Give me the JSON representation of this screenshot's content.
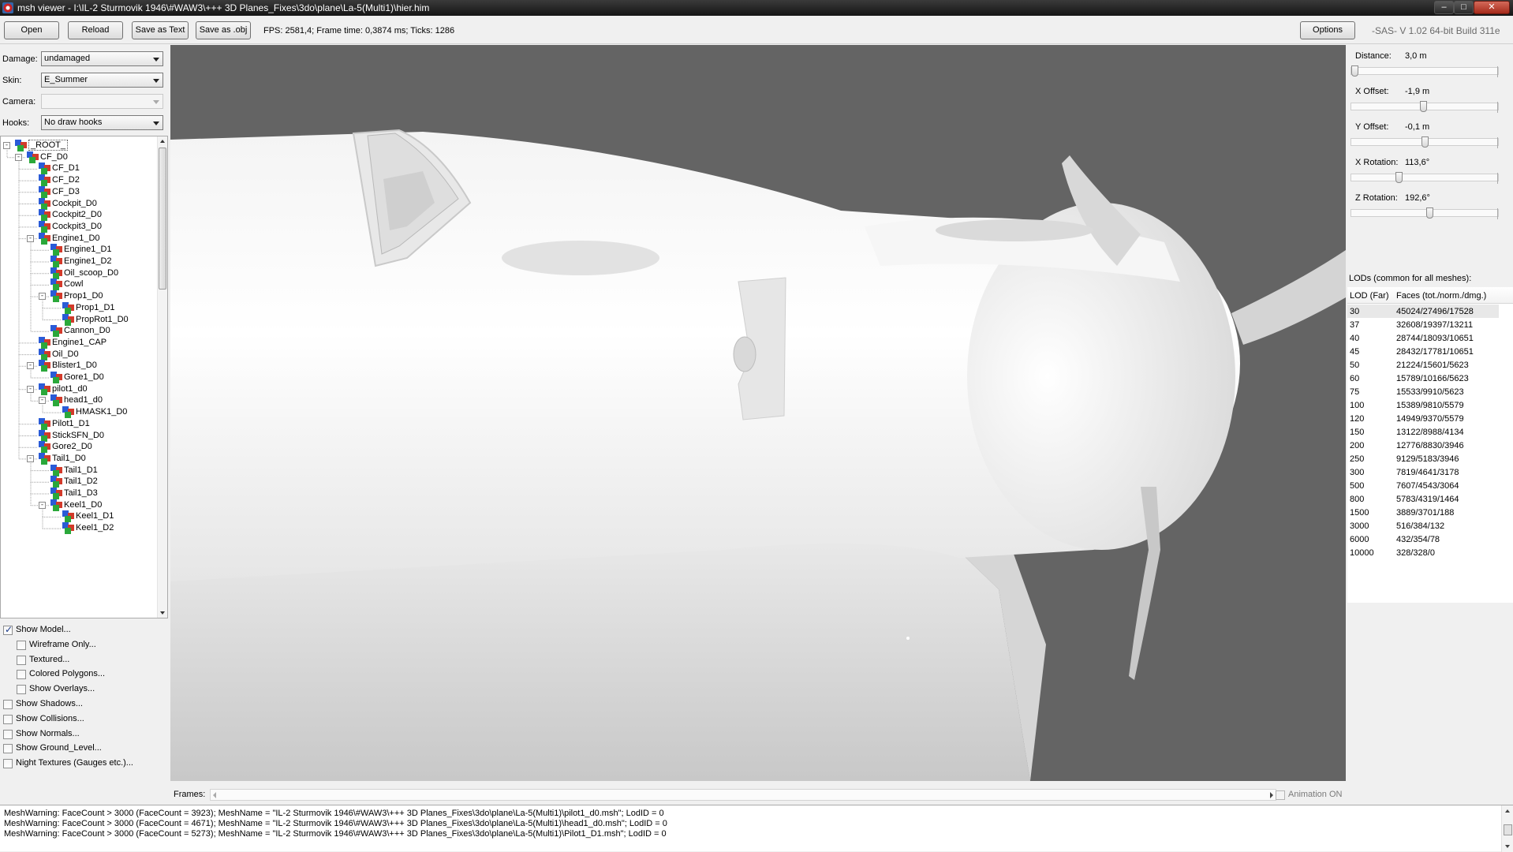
{
  "window": {
    "title": "msh viewer - I:\\IL-2 Sturmovik 1946\\#WAW3\\+++ 3D Planes_Fixes\\3do\\plane\\La-5(Multi1)\\hier.him",
    "minimize": "–",
    "maximize": "□",
    "close": "✕"
  },
  "toolbar": {
    "open": "Open",
    "reload": "Reload",
    "save_text": "Save as Text",
    "save_obj": "Save as .obj",
    "fps": "FPS: 2581,4; Frame time: 0,3874 ms; Ticks: 1286",
    "options": "Options",
    "version": "-SAS- V 1.02  64-bit  Build 311e"
  },
  "fields": {
    "damage_label": "Damage:",
    "damage_value": "undamaged",
    "skin_label": "Skin:",
    "skin_value": "E_Summer",
    "camera_label": "Camera:",
    "camera_value": "",
    "hooks_label": "Hooks:",
    "hooks_value": "No draw hooks"
  },
  "tree": [
    {
      "label": "_ROOT_",
      "depth": 0,
      "exp": "-"
    },
    {
      "label": "CF_D0",
      "depth": 1,
      "exp": "-"
    },
    {
      "label": "CF_D1",
      "depth": 2,
      "exp": ""
    },
    {
      "label": "CF_D2",
      "depth": 2,
      "exp": ""
    },
    {
      "label": "CF_D3",
      "depth": 2,
      "exp": ""
    },
    {
      "label": "Cockpit_D0",
      "depth": 2,
      "exp": ""
    },
    {
      "label": "Cockpit2_D0",
      "depth": 2,
      "exp": ""
    },
    {
      "label": "Cockpit3_D0",
      "depth": 2,
      "exp": ""
    },
    {
      "label": "Engine1_D0",
      "depth": 2,
      "exp": "-"
    },
    {
      "label": "Engine1_D1",
      "depth": 3,
      "exp": ""
    },
    {
      "label": "Engine1_D2",
      "depth": 3,
      "exp": ""
    },
    {
      "label": "Oil_scoop_D0",
      "depth": 3,
      "exp": ""
    },
    {
      "label": "Cowl",
      "depth": 3,
      "exp": ""
    },
    {
      "label": "Prop1_D0",
      "depth": 3,
      "exp": "-"
    },
    {
      "label": "Prop1_D1",
      "depth": 4,
      "exp": ""
    },
    {
      "label": "PropRot1_D0",
      "depth": 4,
      "exp": ""
    },
    {
      "label": "Cannon_D0",
      "depth": 3,
      "exp": ""
    },
    {
      "label": "Engine1_CAP",
      "depth": 2,
      "exp": ""
    },
    {
      "label": "Oil_D0",
      "depth": 2,
      "exp": ""
    },
    {
      "label": "Blister1_D0",
      "depth": 2,
      "exp": "-"
    },
    {
      "label": "Gore1_D0",
      "depth": 3,
      "exp": ""
    },
    {
      "label": "pilot1_d0",
      "depth": 2,
      "exp": "-"
    },
    {
      "label": "head1_d0",
      "depth": 3,
      "exp": "-"
    },
    {
      "label": "HMASK1_D0",
      "depth": 4,
      "exp": ""
    },
    {
      "label": "Pilot1_D1",
      "depth": 2,
      "exp": ""
    },
    {
      "label": "StickSFN_D0",
      "depth": 2,
      "exp": ""
    },
    {
      "label": "Gore2_D0",
      "depth": 2,
      "exp": ""
    },
    {
      "label": "Tail1_D0",
      "depth": 2,
      "exp": "-"
    },
    {
      "label": "Tail1_D1",
      "depth": 3,
      "exp": ""
    },
    {
      "label": "Tail1_D2",
      "depth": 3,
      "exp": ""
    },
    {
      "label": "Tail1_D3",
      "depth": 3,
      "exp": ""
    },
    {
      "label": "Keel1_D0",
      "depth": 3,
      "exp": "-"
    },
    {
      "label": "Keel1_D1",
      "depth": 4,
      "exp": ""
    },
    {
      "label": "Keel1_D2",
      "depth": 4,
      "exp": ""
    }
  ],
  "checkboxes": [
    {
      "label": "Show Model...",
      "checked": true,
      "indent": 0
    },
    {
      "label": "Wireframe Only...",
      "checked": false,
      "indent": 1
    },
    {
      "label": "Textured...",
      "checked": false,
      "indent": 1
    },
    {
      "label": "Colored Polygons...",
      "checked": false,
      "indent": 1
    },
    {
      "label": "Show Overlays...",
      "checked": false,
      "indent": 1
    },
    {
      "label": "Show Shadows...",
      "checked": false,
      "indent": 0
    },
    {
      "label": "Show Collisions...",
      "checked": false,
      "indent": 0
    },
    {
      "label": "Show Normals...",
      "checked": false,
      "indent": 0
    },
    {
      "label": "Show Ground_Level...",
      "checked": false,
      "indent": 0
    },
    {
      "label": "Night Textures (Gauges etc.)...",
      "checked": false,
      "indent": 0
    }
  ],
  "frames": {
    "label": "Frames:",
    "animation": "Animation ON"
  },
  "log": [
    "MeshWarning: FaceCount > 3000 (FaceCount = 3923); MeshName = \"IL-2 Sturmovik 1946\\#WAW3\\+++ 3D Planes_Fixes\\3do\\plane\\La-5(Multi1)\\pilot1_d0.msh\"; LodID = 0",
    "MeshWarning: FaceCount > 3000 (FaceCount = 4671); MeshName = \"IL-2 Sturmovik 1946\\#WAW3\\+++ 3D Planes_Fixes\\3do\\plane\\La-5(Multi1)\\head1_d0.msh\"; LodID = 0",
    "MeshWarning: FaceCount > 3000 (FaceCount = 5273); MeshName = \"IL-2 Sturmovik 1946\\#WAW3\\+++ 3D Planes_Fixes\\3do\\plane\\La-5(Multi1)\\Pilot1_D1.msh\"; LodID = 0"
  ],
  "params": [
    {
      "label": "Distance:",
      "value": "3,0 m",
      "level": 0.02
    },
    {
      "label": "X Offset:",
      "value": "-1,9 m",
      "level": 0.49
    },
    {
      "label": "Y Offset:",
      "value": "-0,1 m",
      "level": 0.5
    },
    {
      "label": "X Rotation:",
      "value": "113,6°",
      "level": 0.32
    },
    {
      "label": "Z Rotation:",
      "value": "192,6°",
      "level": 0.53
    }
  ],
  "lods": {
    "title": "LODs (common for all meshes):",
    "col_lod": "LOD (Far)",
    "col_faces": "Faces (tot./norm./dmg.)",
    "rows": [
      {
        "lod": "30",
        "faces": "45024/27496/17528"
      },
      {
        "lod": "37",
        "faces": "32608/19397/13211"
      },
      {
        "lod": "40",
        "faces": "28744/18093/10651"
      },
      {
        "lod": "45",
        "faces": "28432/17781/10651"
      },
      {
        "lod": "50",
        "faces": "21224/15601/5623"
      },
      {
        "lod": "60",
        "faces": "15789/10166/5623"
      },
      {
        "lod": "75",
        "faces": "15533/9910/5623"
      },
      {
        "lod": "100",
        "faces": "15389/9810/5579"
      },
      {
        "lod": "120",
        "faces": "14949/9370/5579"
      },
      {
        "lod": "150",
        "faces": "13122/8988/4134"
      },
      {
        "lod": "200",
        "faces": "12776/8830/3946"
      },
      {
        "lod": "250",
        "faces": "9129/5183/3946"
      },
      {
        "lod": "300",
        "faces": "7819/4641/3178"
      },
      {
        "lod": "500",
        "faces": "7607/4543/3064"
      },
      {
        "lod": "800",
        "faces": "5783/4319/1464"
      },
      {
        "lod": "1500",
        "faces": "3889/3701/188"
      },
      {
        "lod": "3000",
        "faces": "516/384/132"
      },
      {
        "lod": "6000",
        "faces": "432/354/78"
      },
      {
        "lod": "10000",
        "faces": "328/328/0"
      }
    ]
  }
}
